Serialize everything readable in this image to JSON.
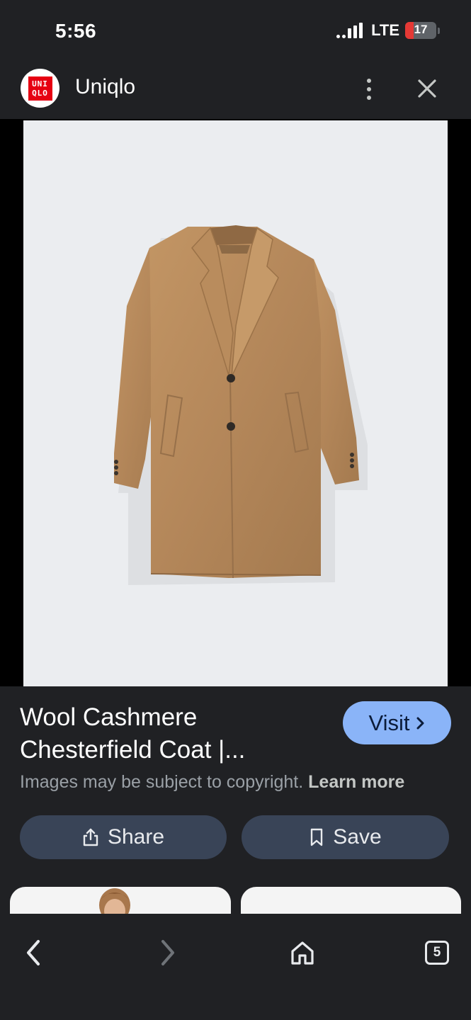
{
  "status_bar": {
    "time": "5:56",
    "network": "LTE",
    "battery_level": "17",
    "battery_color": "#e53935"
  },
  "header": {
    "site_logo_lines": [
      "UNI",
      "QLO"
    ],
    "site_logo_color": "#e60012",
    "site_name": "Uniqlo",
    "more_icon": "more-vert-icon",
    "close_icon": "close-icon"
  },
  "image": {
    "subject": "camel-coat",
    "background_color": "#ebedf0"
  },
  "result": {
    "title": "Wool Cashmere Chesterfield Coat |...",
    "visit_label": "Visit",
    "visit_color": "#8ab4f8",
    "copyright_text": "Images may be subject to copyright.",
    "learn_more_label": "Learn more"
  },
  "actions": {
    "share_label": "Share",
    "share_icon": "share-icon",
    "save_label": "Save",
    "save_icon": "bookmark-icon",
    "button_color": "#394457"
  },
  "bottom_nav": {
    "back_icon": "chevron-left-icon",
    "forward_icon": "chevron-right-icon",
    "home_icon": "home-icon",
    "tab_count": "5"
  }
}
